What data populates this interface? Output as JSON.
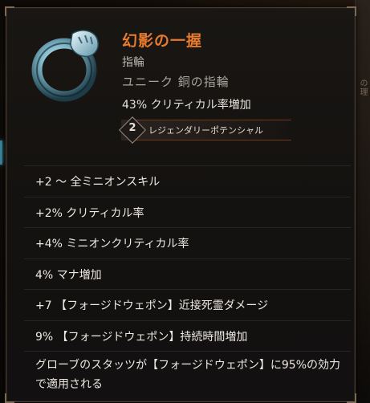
{
  "item": {
    "name": "幻影の一握",
    "type": "指輪",
    "rarity": "ユニーク 銅の指輪",
    "implicit": "43% クリティカル率増加",
    "potential": {
      "number": "2",
      "label": "レジェンダリーポテンシャル"
    }
  },
  "affixes": [
    "+2 〜 全ミニオンスキル",
    "+2% クリティカル率",
    "+4% ミニオンクリティカル率",
    "4% マナ増加",
    "+7 【フォージドウェポン】近接死霊ダメージ",
    "9% 【フォージドウェポン】持続時間増加",
    "グローブのスタッツが【フォージドウェポン】に95%の効力で適用される"
  ],
  "side_glyph": "の理",
  "colors": {
    "name": "#e67a2f",
    "text": "#ece8e2",
    "border": "#4a3e33",
    "potential_line": "#6a3a1e"
  },
  "icons": {
    "item_icon": "silver-fist-ring"
  }
}
